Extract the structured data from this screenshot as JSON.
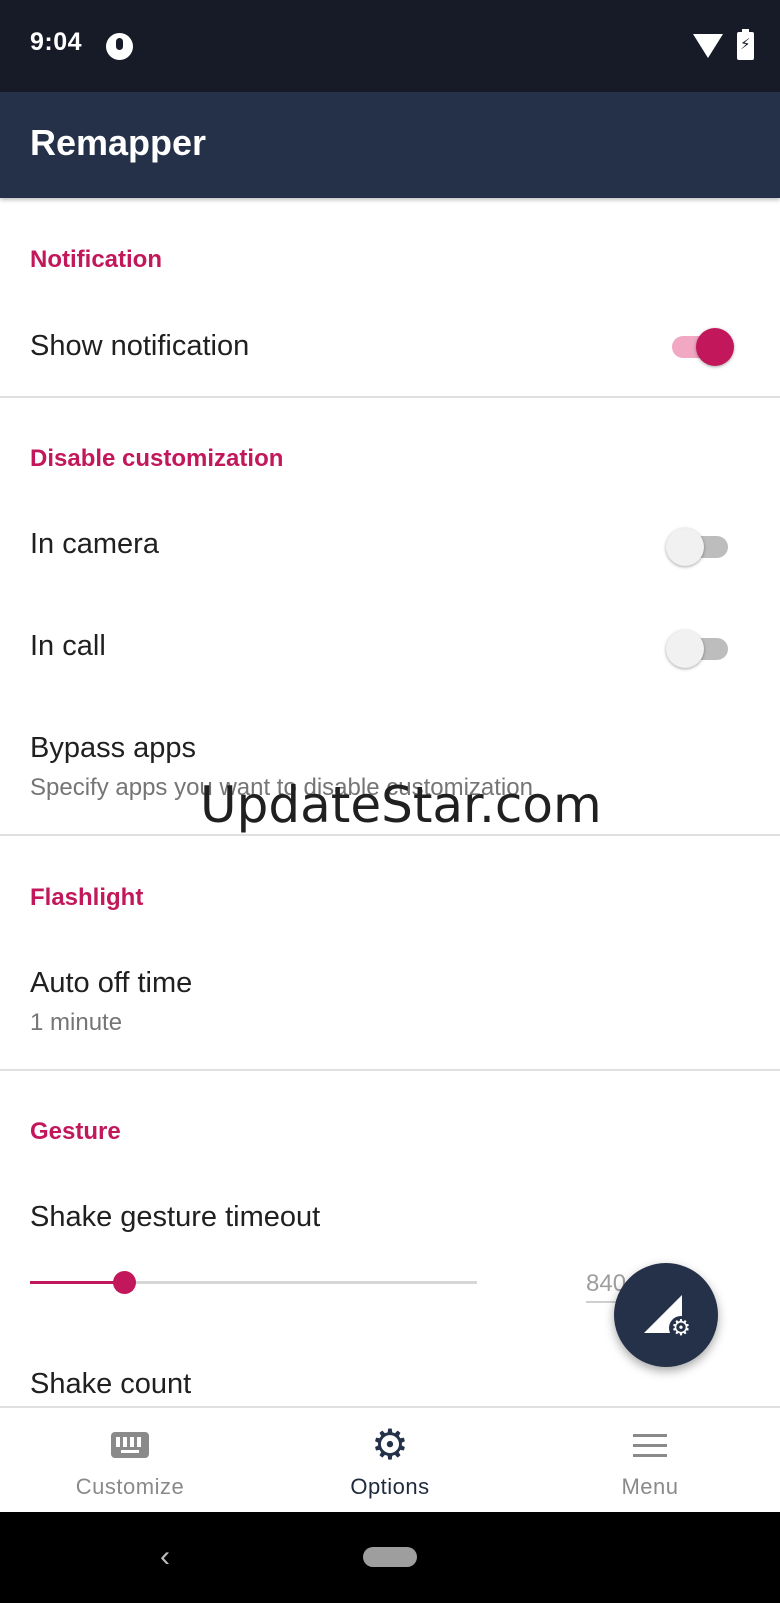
{
  "status_bar": {
    "time": "9:04"
  },
  "app_bar": {
    "title": "Remapper"
  },
  "sections": {
    "notification": {
      "header": "Notification",
      "show_notification": {
        "title": "Show notification",
        "enabled": true
      }
    },
    "disable_customization": {
      "header": "Disable customization",
      "in_camera": {
        "title": "In camera",
        "enabled": false
      },
      "in_call": {
        "title": "In call",
        "enabled": false
      },
      "bypass_apps": {
        "title": "Bypass apps",
        "summary": "Specify apps you want to disable customization"
      }
    },
    "flashlight": {
      "header": "Flashlight",
      "auto_off_time": {
        "title": "Auto off time",
        "summary": "1 minute"
      }
    },
    "gesture": {
      "header": "Gesture",
      "shake_timeout": {
        "title": "Shake gesture timeout",
        "value": "840",
        "fraction": 0.21
      },
      "shake_count": {
        "title": "Shake count"
      }
    }
  },
  "watermark": "UpdateStar.com",
  "bottom_nav": [
    {
      "label": "Customize",
      "icon": "keyboard-icon",
      "active": false
    },
    {
      "label": "Options",
      "icon": "gear-icon",
      "active": true
    },
    {
      "label": "Menu",
      "icon": "menu-icon",
      "active": false
    }
  ],
  "colors": {
    "accent": "#c2185b",
    "app_bar": "#243148",
    "status_bar": "#161b27"
  }
}
